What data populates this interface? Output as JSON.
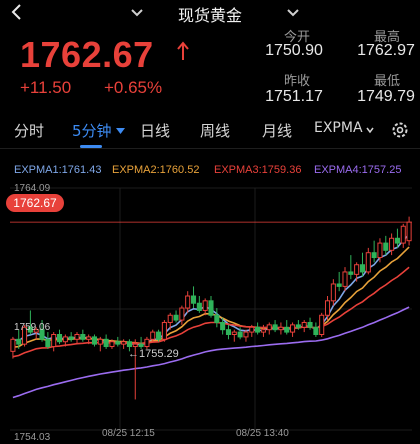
{
  "header": {
    "title": "现货黄金"
  },
  "quote": {
    "price": "1762.67",
    "change": "+11.50",
    "change_pct": "+0.65%",
    "stats": [
      {
        "label": "今开",
        "value": "1750.90"
      },
      {
        "label": "最高",
        "value": "1762.97"
      },
      {
        "label": "昨收",
        "value": "1751.17"
      },
      {
        "label": "最低",
        "value": "1749.79"
      }
    ]
  },
  "tabs": [
    {
      "label": "分时"
    },
    {
      "label": "5分钟"
    },
    {
      "label": "日线"
    },
    {
      "label": "周线"
    },
    {
      "label": "月线"
    },
    {
      "label": "EXPMA"
    }
  ],
  "legend": [
    {
      "label": "EXPMA1:1761.43",
      "color": "#7fa7e8"
    },
    {
      "label": "EXPMA2:1760.52",
      "color": "#e8a23a"
    },
    {
      "label": "EXPMA3:1759.36",
      "color": "#e8413a"
    },
    {
      "label": "EXPMA4:1757.25",
      "color": "#9b6cf0"
    }
  ],
  "chart": {
    "y_top": "1764.09",
    "y_mid": "1759.06",
    "y_bottom": "1754.03",
    "last_price_tag": "1762.67",
    "low_annotation": "←1755.29",
    "x_labels": [
      "08/25 12:15",
      "08/25 13:40"
    ]
  },
  "colors": {
    "up": "#e8413a",
    "down": "#2fb35a",
    "accent": "#3d8bf2"
  },
  "chart_data": {
    "type": "candlestick",
    "ylim": [
      1754.03,
      1764.09
    ],
    "candles": [
      [
        1757.3,
        1757.9,
        1757.0,
        1757.8
      ],
      [
        1757.8,
        1758.2,
        1757.4,
        1757.6
      ],
      [
        1757.6,
        1758.4,
        1757.5,
        1758.3
      ],
      [
        1758.3,
        1759.0,
        1758.0,
        1758.1
      ],
      [
        1758.1,
        1758.3,
        1757.8,
        1758.2
      ],
      [
        1758.2,
        1758.6,
        1757.7,
        1757.8
      ],
      [
        1757.8,
        1758.1,
        1757.4,
        1757.5
      ],
      [
        1757.5,
        1758.1,
        1757.3,
        1758.0
      ],
      [
        1758.0,
        1758.2,
        1757.6,
        1757.7
      ],
      [
        1757.7,
        1758.0,
        1757.5,
        1757.9
      ],
      [
        1757.9,
        1758.1,
        1757.7,
        1757.8
      ],
      [
        1757.8,
        1758.1,
        1757.6,
        1758.0
      ],
      [
        1758.0,
        1758.2,
        1757.7,
        1757.8
      ],
      [
        1757.8,
        1758.0,
        1757.6,
        1757.9
      ],
      [
        1757.9,
        1758.0,
        1757.5,
        1757.6
      ],
      [
        1757.6,
        1757.9,
        1757.3,
        1757.8
      ],
      [
        1757.8,
        1758.0,
        1757.4,
        1757.5
      ],
      [
        1757.5,
        1757.8,
        1757.4,
        1757.7
      ],
      [
        1757.7,
        1757.9,
        1757.5,
        1757.6
      ],
      [
        1757.6,
        1757.8,
        1757.4,
        1757.7
      ],
      [
        1757.7,
        1757.8,
        1757.3,
        1757.5
      ],
      [
        1757.5,
        1757.8,
        1755.3,
        1757.6
      ],
      [
        1757.6,
        1757.9,
        1757.4,
        1757.5
      ],
      [
        1757.5,
        1757.9,
        1757.4,
        1757.8
      ],
      [
        1757.8,
        1758.2,
        1757.7,
        1758.1
      ],
      [
        1758.1,
        1758.2,
        1757.7,
        1757.8
      ],
      [
        1757.8,
        1758.6,
        1757.7,
        1758.5
      ],
      [
        1758.5,
        1758.9,
        1758.2,
        1758.8
      ],
      [
        1758.8,
        1759.0,
        1758.5,
        1758.6
      ],
      [
        1758.6,
        1759.2,
        1758.4,
        1759.1
      ],
      [
        1759.1,
        1759.8,
        1758.9,
        1759.6
      ],
      [
        1759.6,
        1760.0,
        1759.1,
        1759.3
      ],
      [
        1759.3,
        1759.6,
        1758.9,
        1759.0
      ],
      [
        1759.0,
        1759.5,
        1758.8,
        1759.4
      ],
      [
        1759.4,
        1759.6,
        1758.7,
        1758.8
      ],
      [
        1758.8,
        1759.1,
        1758.3,
        1758.5
      ],
      [
        1758.5,
        1758.7,
        1758.0,
        1758.2
      ],
      [
        1758.2,
        1758.4,
        1757.8,
        1758.0
      ],
      [
        1758.0,
        1758.2,
        1757.7,
        1758.1
      ],
      [
        1758.1,
        1758.3,
        1757.8,
        1757.9
      ],
      [
        1757.9,
        1758.2,
        1757.7,
        1758.1
      ],
      [
        1758.1,
        1758.4,
        1757.9,
        1758.3
      ],
      [
        1758.3,
        1758.5,
        1758.0,
        1758.1
      ],
      [
        1758.1,
        1758.4,
        1757.9,
        1758.2
      ],
      [
        1758.2,
        1758.5,
        1758.0,
        1758.4
      ],
      [
        1758.4,
        1758.6,
        1758.1,
        1758.2
      ],
      [
        1758.2,
        1758.5,
        1758.0,
        1758.3
      ],
      [
        1758.3,
        1758.6,
        1758.0,
        1758.1
      ],
      [
        1758.1,
        1758.5,
        1757.9,
        1758.4
      ],
      [
        1758.4,
        1758.6,
        1758.2,
        1758.3
      ],
      [
        1758.3,
        1758.6,
        1758.1,
        1758.5
      ],
      [
        1758.5,
        1758.7,
        1758.2,
        1758.3
      ],
      [
        1758.3,
        1758.5,
        1757.9,
        1758.0
      ],
      [
        1758.0,
        1758.9,
        1757.9,
        1758.8
      ],
      [
        1758.8,
        1759.6,
        1758.6,
        1759.4
      ],
      [
        1759.4,
        1760.3,
        1759.2,
        1760.1
      ],
      [
        1760.1,
        1760.6,
        1759.8,
        1760.0
      ],
      [
        1760.0,
        1760.8,
        1759.8,
        1760.6
      ],
      [
        1760.6,
        1761.3,
        1760.3,
        1760.5
      ],
      [
        1760.5,
        1761.0,
        1760.2,
        1760.9
      ],
      [
        1760.9,
        1761.4,
        1760.4,
        1760.6
      ],
      [
        1760.6,
        1761.6,
        1760.5,
        1761.4
      ],
      [
        1761.4,
        1761.9,
        1761.0,
        1761.2
      ],
      [
        1761.2,
        1762.0,
        1761.0,
        1761.8
      ],
      [
        1761.8,
        1762.1,
        1761.3,
        1761.5
      ],
      [
        1761.5,
        1762.2,
        1761.3,
        1762.0
      ],
      [
        1762.0,
        1762.4,
        1761.6,
        1761.8
      ],
      [
        1761.8,
        1762.6,
        1761.6,
        1762.5
      ],
      [
        1761.9,
        1762.9,
        1761.7,
        1762.67
      ]
    ]
  }
}
